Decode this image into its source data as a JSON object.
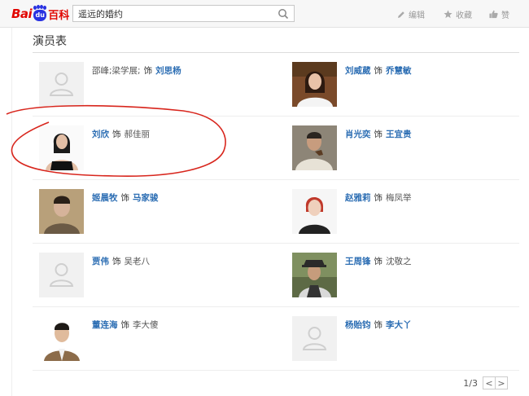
{
  "header": {
    "logo_bai": "Bai",
    "logo_du": "du",
    "logo_baike": "百科",
    "search_value": "遥远的婚约",
    "edit_label": "编辑",
    "favorite_label": "收藏",
    "like_label": "赞"
  },
  "section": {
    "title": "演员表"
  },
  "cast": [
    {
      "actor": "邵峰;梁学展;",
      "actor_link": false,
      "role": "饰",
      "character": "刘思杨",
      "character_link": true,
      "photo": "placeholder"
    },
    {
      "actor": "刘威葳",
      "actor_link": true,
      "role": "饰",
      "character": "乔慧敏",
      "character_link": true,
      "photo": "woman-white"
    },
    {
      "actor": "刘欣",
      "actor_link": true,
      "role": "饰",
      "character": "郝佳丽",
      "character_link": false,
      "photo": "woman-black"
    },
    {
      "actor": "肖光奕",
      "actor_link": true,
      "role": "饰",
      "character": "王宜贵",
      "character_link": true,
      "photo": "man-pipe"
    },
    {
      "actor": "姬晨牧",
      "actor_link": true,
      "role": "饰",
      "character": "马家骏",
      "character_link": true,
      "photo": "man-young"
    },
    {
      "actor": "赵雅莉",
      "actor_link": true,
      "role": "饰",
      "character": "梅凤举",
      "character_link": false,
      "photo": "woman-short"
    },
    {
      "actor": "贾伟",
      "actor_link": true,
      "role": "饰",
      "character": "吴老八",
      "character_link": false,
      "photo": "placeholder"
    },
    {
      "actor": "王周锋",
      "actor_link": true,
      "role": "饰",
      "character": "沈敬之",
      "character_link": false,
      "photo": "man-hat"
    },
    {
      "actor": "董连海",
      "actor_link": true,
      "role": "饰",
      "character": "李大傻",
      "character_link": false,
      "photo": "man-suit"
    },
    {
      "actor": "杨贻钧",
      "actor_link": true,
      "role": "饰",
      "character": "李大丫",
      "character_link": true,
      "photo": "placeholder"
    }
  ],
  "pager": {
    "text": "1/3",
    "prev": "<",
    "next": ">"
  },
  "colors": {
    "link": "#2b6db3",
    "brand_red": "#e10601",
    "brand_blue": "#2932e1",
    "annotation": "#d8261d"
  }
}
